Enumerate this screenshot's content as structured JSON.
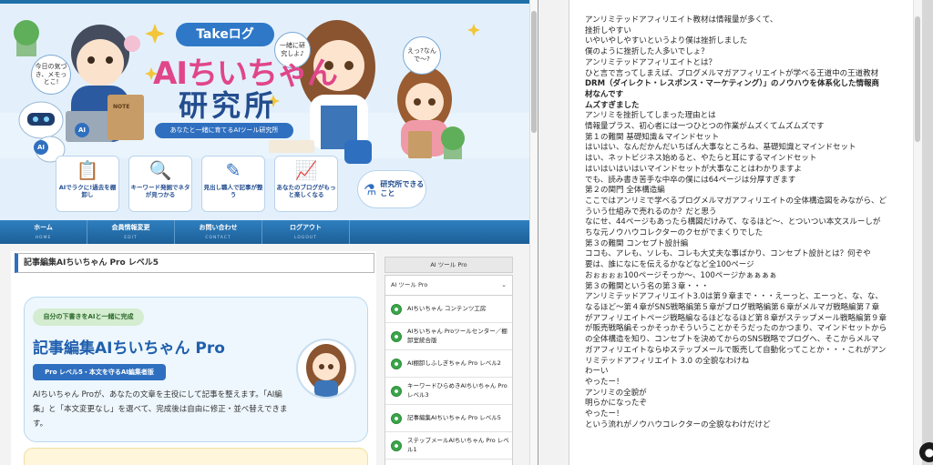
{
  "banner": {
    "logo_pill": "Takeログ",
    "logo_title": "AIちいちゃん",
    "logo_subtitle": "研究所",
    "tagline": "あなたと一緒に育てるAIツール研究所",
    "bubble_left": "今日の気づき、メモっとこ!",
    "bubble_mid": "一緒に研究しよ♪",
    "bubble_right": "えっ?なんで〜?",
    "robot_label": "AI",
    "laptop_label": "AI",
    "note_label": "NOTE",
    "features": [
      {
        "icon": "clipboard-icon",
        "label": "AIでラクに!過去を棚卸し"
      },
      {
        "icon": "magnifier-icon",
        "label": "キーワード発掘でネタが見つかる"
      },
      {
        "icon": "pen-icon",
        "label": "見出し職人で記事が整う"
      },
      {
        "icon": "growth-chart-icon",
        "label": "あなたのブログがもっと楽しくなる"
      }
    ],
    "lab_button": "研究所できること"
  },
  "nav": {
    "items": [
      {
        "label": "ホーム",
        "sub": "HOME"
      },
      {
        "label": "会員情報変更",
        "sub": "EDIT"
      },
      {
        "label": "お問い合わせ",
        "sub": "CONTACT"
      },
      {
        "label": "ログアウト",
        "sub": "LOGOUT"
      }
    ]
  },
  "post": {
    "title": "記事編集AIちいちゃん Pro レベル5",
    "pill": "自分の下書きをAIと一緒に完成",
    "hero_title": "記事編集AIちいちゃん Pro",
    "badge": "Pro レベル5・本文を守るAI編集者版",
    "description": "AIちいちゃん Proが、あなたの文章を主役にして記事を整えます。「AI編集」と「本文変更なし」を選べて、完成後は自由に修正・並べ替えできます。"
  },
  "sidebar": {
    "title": "AI ツール Pro",
    "dropdown": "AI ツール Pro",
    "items": [
      "AIちいちゃん コンテンツ工房",
      "AIちいちゃん Proツールセンター／棚卸室統合版",
      "AI棚卸しふしぎちゃん Pro レベル2",
      "キーワードひらめきAIちいちゃん Pro レベル3",
      "記事編集AIちいちゃん Pro レベル5",
      "ステップメールAIちいちゃん Pro レベル1"
    ]
  },
  "notes": {
    "lines": [
      {
        "t": "アンリミテッドアフィリエイト教材は情報量が多くて、",
        "b": false
      },
      {
        "t": "挫折しやすい",
        "b": false
      },
      {
        "t": "いやいやしやすいというより僕は挫折しました",
        "b": false
      },
      {
        "t": "僕のように挫折した人多いでしょ？",
        "b": false
      },
      {
        "t": "アンリミテッドアフィリエイトとは？",
        "b": false
      },
      {
        "t": "ひと言で言ってしまえば、ブログメルマガアフィリエイトが学べる王道中の王道教材",
        "b": false
      },
      {
        "t": "DRM（ダイレクト・レスポンス・マーケティング）」のノウハウを体系化した情報商",
        "b": true
      },
      {
        "t": "材なんです",
        "b": true
      },
      {
        "t": "ムズすぎました",
        "b": true
      },
      {
        "t": "アンリミを挫折してしまった理由とは",
        "b": false
      },
      {
        "t": "情報量プラス、初心者には一つひとつの作業がムズくてムズムズです",
        "b": false
      },
      {
        "t": "第１の難関 基礎知識＆マインドセット",
        "b": false
      },
      {
        "t": "はいはい、なんだかんだいちばん大事なところね、基礎知識とマインドセット",
        "b": false
      },
      {
        "t": "はい、ネットビジネス始めると、やたらと耳にするマインドセット",
        "b": false
      },
      {
        "t": "はいはいはいはいマインドセットが大事なことはわかりますよ",
        "b": false
      },
      {
        "t": "でも、読み書き苦手な中卒の僕には64ページは分厚すぎます",
        "b": false
      },
      {
        "t": "第２の関門 全体構造編",
        "b": false
      },
      {
        "t": "ここではアンリミで学べるブログメルマガアフィリエイトの全体構造図をみながら、ど",
        "b": false
      },
      {
        "t": "ういう仕組みで売れるのか？だと思う",
        "b": false
      },
      {
        "t": "なにせ、44ページもあったら構図だけみて、なるほど〜、とついつい本文スルーしが",
        "b": false
      },
      {
        "t": "ちな元ノウハウコレクターのクセがでまくりでした",
        "b": false
      },
      {
        "t": "第３の難関 コンセプト設計編",
        "b": false
      },
      {
        "t": "ココも、アレも、ソレも、コレも大丈夫な事ばかり、コンセプト設計とは？何ぞや",
        "b": false
      },
      {
        "t": "要は、誰になにを伝えるかなどなど全100ページ",
        "b": false
      },
      {
        "t": "おぉぉぉぉ100ページそっか〜、100ページかぁぁぁぁ",
        "b": false
      },
      {
        "t": "第３の難関という名の第３章・・・",
        "b": false
      },
      {
        "t": "アンリミテッドアフィリエイト3.0は第９章まで・・・えーっと、エーっと、な、な、",
        "b": false
      },
      {
        "t": "なるほど〜第４章がSNS戦略編第５章がブログ戦略編第６章がメルマガ戦略編第７章",
        "b": false
      },
      {
        "t": "がアフィリエイトページ戦略編なるほどなるほど第８章がステップメール戦略編第９章",
        "b": false
      },
      {
        "t": "が販売戦略編そっかそっかそういうことかそうだったのかつまり、マインドセットから",
        "b": false
      },
      {
        "t": "の全体構造を知り、コンセプトを決めてからのSNS戦略でブログへ、そこからメルマ",
        "b": false
      },
      {
        "t": "ガアフィリエイトならゆステップメールで販売して自動化ってことか・・・これがアン",
        "b": false
      },
      {
        "t": "リミテッドアフィリエイト 3.0 の全貌なわけね",
        "b": false
      },
      {
        "t": "わーい",
        "b": false
      },
      {
        "t": "やったー！",
        "b": false
      },
      {
        "t": "アンリミの全貌が",
        "b": false
      },
      {
        "t": "明らかになったぞ",
        "b": false
      },
      {
        "t": "やったー！",
        "b": false
      },
      {
        "t": "という流れがノウハウコレクターの全貌なわけだけど",
        "b": false
      }
    ]
  },
  "colors": {
    "accent": "#2f6fbf",
    "brand_pink": "#e0468a",
    "nav_blue": "#1c5f98",
    "sidebar_dot": "#3aa64a"
  }
}
